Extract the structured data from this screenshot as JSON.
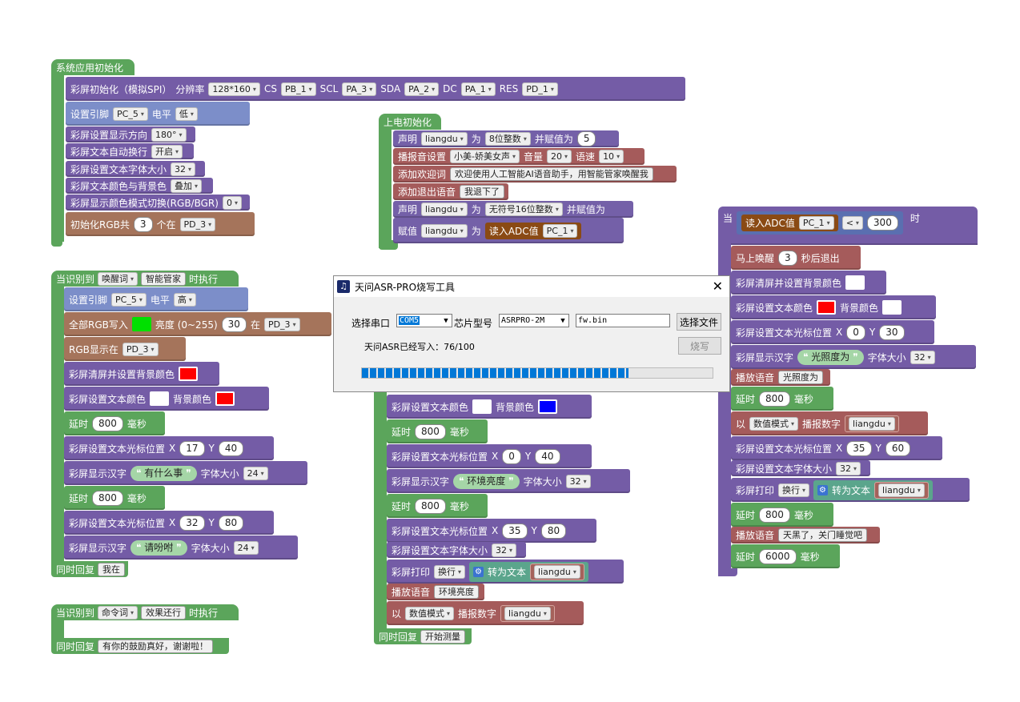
{
  "colors": {
    "event": "#5ba55b",
    "lcd": "#745ca6",
    "rgb": "#a5745b",
    "voice": "#a55b5b",
    "pin": "#7c8ec9",
    "var": "#a5625b"
  },
  "sys_init": {
    "title": "系统应用初始化",
    "lcd_init": {
      "label": "彩屏初始化（模拟SPI）",
      "res_label": "分辨率",
      "res": "128*160",
      "cs_label": "CS",
      "cs": "PB_1",
      "scl_label": "SCL",
      "scl": "PA_3",
      "sda_label": "SDA",
      "sda": "PA_2",
      "dc_label": "DC",
      "dc": "PA_1",
      "rst_label": "RES",
      "rst": "PD_1"
    },
    "set_pin": {
      "label": "设置引脚",
      "pin": "PC_5",
      "level_label": "电平",
      "level": "低"
    },
    "dir": {
      "label": "彩屏设置显示方向",
      "value": "180°"
    },
    "wrap": {
      "label": "彩屏文本自动换行",
      "value": "开启"
    },
    "font": {
      "label": "彩屏设置文本字体大小",
      "value": "32"
    },
    "textcolor": {
      "label": "彩屏文本颜色与背景色",
      "value": "叠加"
    },
    "colormode": {
      "label": "彩屏显示颜色模式切换(RGB/BGR)",
      "value": "0"
    },
    "rgbinit": {
      "label": "初始化RGB共",
      "count": "3",
      "at_label": "个在",
      "pin": "PD_3"
    }
  },
  "power_on": {
    "title": "上电初始化",
    "decl1": {
      "label": "声明",
      "var": "liangdu",
      "as": "为",
      "type": "8位整数",
      "assign": "并赋值为",
      "value": "5"
    },
    "speaker": {
      "label": "播报音设置",
      "voice": "小美-娇美女声",
      "vol_label": "音量",
      "vol": "20",
      "speed_label": "语速",
      "speed": "10"
    },
    "welcome": {
      "label": "添加欢迎词",
      "text": "欢迎使用人工智能AI语音助手，用智能管家唤醒我"
    },
    "exit": {
      "label": "添加退出语音",
      "text": "我退下了"
    },
    "decl2": {
      "label": "声明",
      "var": "liangdu",
      "as": "为",
      "type": "无符号16位整数",
      "assign": "并赋值为"
    },
    "assign": {
      "label": "赋值",
      "var": "liangdu",
      "as": "为",
      "adc_label": "读入ADC值",
      "pin": "PC_1"
    }
  },
  "wake": {
    "title_pre": "当识别到",
    "kind": "唤醒词",
    "word": "智能管家",
    "title_post": "时执行",
    "set_pin": {
      "label": "设置引脚",
      "pin": "PC_5",
      "level_label": "电平",
      "level": "高"
    },
    "rgb_all": {
      "label": "全部RGB写入",
      "bright_label": "亮度 (0~255)",
      "bright": "30",
      "at": "在",
      "pin": "PD_3"
    },
    "rgb_show": {
      "label": "RGB显示在",
      "pin": "PD_3"
    },
    "clear": {
      "label": "彩屏清屏并设置背景颜色"
    },
    "textcolor": {
      "label": "彩屏设置文本颜色",
      "bg_label": "背景颜色"
    },
    "delay1": {
      "label": "延时",
      "value": "800",
      "unit": "毫秒"
    },
    "cursor1": {
      "label": "彩屏设置文本光标位置",
      "x_label": "X",
      "x": "17",
      "y_label": "Y",
      "y": "40"
    },
    "text1": {
      "label": "彩屏显示汉字",
      "text": "有什么事",
      "size_label": "字体大小",
      "size": "24"
    },
    "delay2": {
      "label": "延时",
      "value": "800",
      "unit": "毫秒"
    },
    "cursor2": {
      "label": "彩屏设置文本光标位置",
      "x_label": "X",
      "x": "32",
      "y_label": "Y",
      "y": "80"
    },
    "text2": {
      "label": "彩屏显示汉字",
      "text": "请吩咐",
      "size_label": "字体大小",
      "size": "24"
    },
    "reply_label": "同时回复",
    "reply": "我在"
  },
  "cmd": {
    "title_pre": "当识别到",
    "kind": "命令词",
    "word": "效果还行",
    "title_post": "时执行",
    "reply_label": "同时回复",
    "reply": "有你的鼓励真好，谢谢啦！"
  },
  "middle": {
    "textcolor": {
      "label": "彩屏设置文本颜色",
      "bg_label": "背景颜色"
    },
    "delay1": {
      "label": "延时",
      "value": "800",
      "unit": "毫秒"
    },
    "cursor1": {
      "label": "彩屏设置文本光标位置",
      "x_label": "X",
      "x": "0",
      "y_label": "Y",
      "y": "40"
    },
    "text1": {
      "label": "彩屏显示汉字",
      "text": "环境亮度",
      "size_label": "字体大小",
      "size": "32"
    },
    "delay2": {
      "label": "延时",
      "value": "800",
      "unit": "毫秒"
    },
    "cursor2": {
      "label": "彩屏设置文本光标位置",
      "x_label": "X",
      "x": "35",
      "y_label": "Y",
      "y": "80"
    },
    "font": {
      "label": "彩屏设置文本字体大小",
      "value": "32"
    },
    "print": {
      "label": "彩屏打印",
      "mode": "换行",
      "conv": "转为文本",
      "var": "liangdu"
    },
    "say": {
      "label": "播放语音",
      "text": "环境亮度"
    },
    "num": {
      "label": "以",
      "mode": "数值模式",
      "say": "播报数字",
      "var": "liangdu"
    },
    "reply_label": "同时回复",
    "reply": "开始测量"
  },
  "right": {
    "when": "当",
    "adc_label": "读入ADC值",
    "pin": "PC_1",
    "op": "<",
    "value": "300",
    "then": "时",
    "wake": {
      "label": "马上唤醒",
      "value": "3",
      "unit": "秒后退出"
    },
    "clear": {
      "label": "彩屏清屏并设置背景颜色"
    },
    "textcolor": {
      "label": "彩屏设置文本颜色",
      "bg_label": "背景颜色"
    },
    "cursor1": {
      "label": "彩屏设置文本光标位置",
      "x_label": "X",
      "x": "0",
      "y_label": "Y",
      "y": "30"
    },
    "text1": {
      "label": "彩屏显示汉字",
      "text": "光照度为",
      "size_label": "字体大小",
      "size": "32"
    },
    "say1": {
      "label": "播放语音",
      "text": "光照度为"
    },
    "delay1": {
      "label": "延时",
      "value": "800",
      "unit": "毫秒"
    },
    "num": {
      "label": "以",
      "mode": "数值模式",
      "say": "播报数字",
      "var": "liangdu"
    },
    "cursor2": {
      "label": "彩屏设置文本光标位置",
      "x_label": "X",
      "x": "35",
      "y_label": "Y",
      "y": "60"
    },
    "font": {
      "label": "彩屏设置文本字体大小",
      "value": "32"
    },
    "print": {
      "label": "彩屏打印",
      "mode": "换行",
      "conv": "转为文本",
      "var": "liangdu"
    },
    "delay2": {
      "label": "延时",
      "value": "800",
      "unit": "毫秒"
    },
    "say2": {
      "label": "播放语音",
      "text": "天黑了，关门睡觉吧"
    },
    "delay3": {
      "label": "延时",
      "value": "6000",
      "unit": "毫秒"
    }
  },
  "dialog": {
    "title": "天问ASR-PRO烧写工具",
    "port_label": "选择串口",
    "port": "COM5",
    "chip_label": "芯片型号",
    "chip": "ASRPRO-2M",
    "file": "fw.bin",
    "choose": "选择文件",
    "status": "天问ASR已经写入：76/100",
    "burn": "烧写",
    "progress": 0.76
  }
}
